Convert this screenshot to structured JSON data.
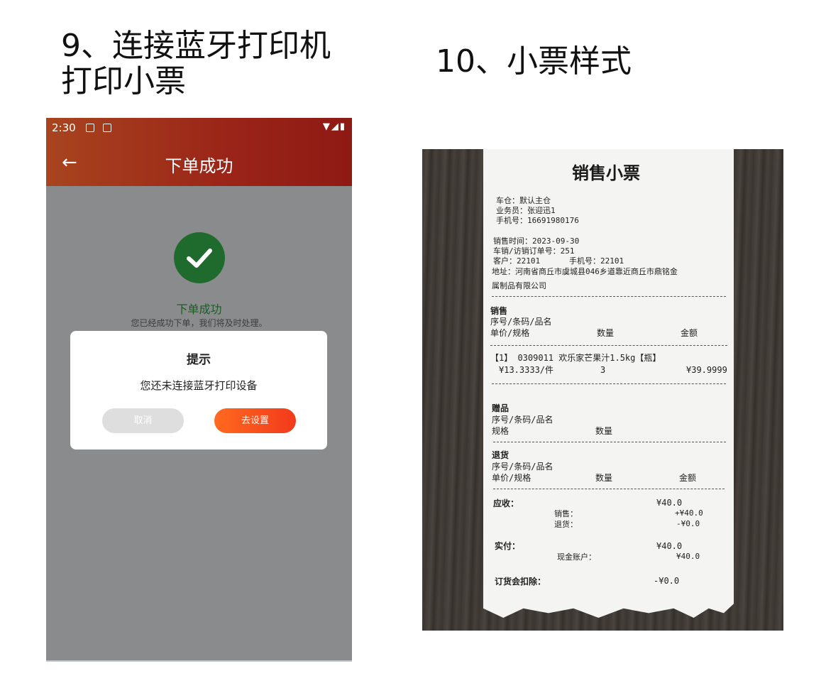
{
  "slide": {
    "left_title": "9、连接蓝牙打印机\n打印小票",
    "right_title": "10、小票样式"
  },
  "phone": {
    "status": {
      "time": "2:30"
    },
    "appbar": {
      "back_icon": "arrow-left-icon",
      "title": "下单成功"
    },
    "success": {
      "icon": "check-circle-icon",
      "title": "下单成功",
      "message": "您已经成功下单，我们将及时处理。"
    },
    "dialog": {
      "title": "提示",
      "message": "您还未连接蓝牙打印设备",
      "cancel_label": "取消",
      "settings_label": "去设置"
    }
  },
  "receipt": {
    "title": "销售小票",
    "warehouse": "车仓：默认主仓",
    "salesman": "业务员：张迎迅1",
    "phone": "手机号：16691980176",
    "sale_time": "销售时间：2023-09-30",
    "order_no": "车销/访销订单号：251",
    "customer": "客户：22101",
    "customer_phone": "手机号：22101",
    "address_line1": "地址：河南省商丘市虞城县046乡道靠近商丘市鼎铭金",
    "address_line2": "属制品有限公司",
    "sales": {
      "heading": "销售",
      "col1": "序号/条码/品名",
      "col2": "单价/规格",
      "col3": "数量",
      "col4": "金额",
      "item_line": "【1】 0309011 欢乐家芒果汁1.5kg【瓶】",
      "item_price": "¥13.3333/件",
      "item_qty": "3",
      "item_amount": "¥39.9999"
    },
    "gifts": {
      "heading": "赠品",
      "col1": "序号/条码/品名",
      "col2": "规格",
      "col3": "数量"
    },
    "returns": {
      "heading": "退货",
      "col1": "序号/条码/品名",
      "col2": "单价/规格",
      "col3": "数量",
      "col4": "金额"
    },
    "summary": {
      "receivable_label": "应收：",
      "receivable": "¥40.0",
      "sales_label": "销售：",
      "sales": "+¥40.0",
      "returns_label": "退货：",
      "returns": "-¥0.0",
      "paid_label": "实付：",
      "paid": "¥40.0",
      "cash_label": "现金账户：",
      "cash": "¥40.0",
      "deduct_label": "订货会扣除：",
      "deduct": "-¥0.0"
    }
  }
}
